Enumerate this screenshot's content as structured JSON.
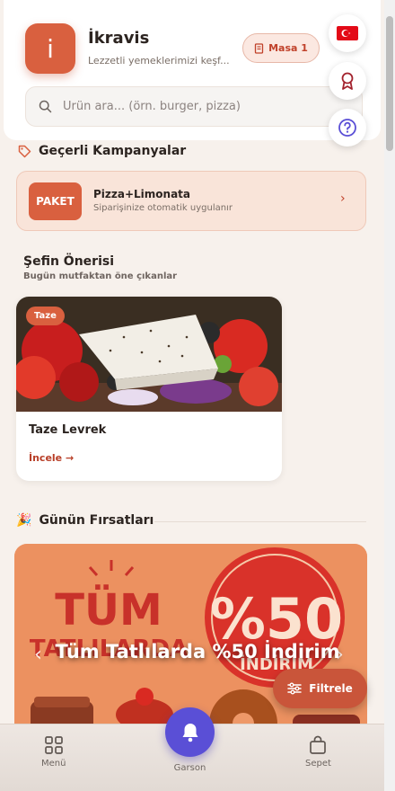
{
  "header": {
    "logo_letter": "i",
    "title": "İkravis",
    "subtitle": "Lezzetli yemeklerimizi keşf...",
    "table_label": "Masa 1"
  },
  "search": {
    "placeholder": "Ürün ara... (örn. burger, pizza)"
  },
  "fabs": [
    {
      "icon": "turkey-flag-icon"
    },
    {
      "icon": "award-icon"
    },
    {
      "icon": "help-icon"
    }
  ],
  "campaigns": {
    "heading": "Geçerli Kampanyalar",
    "items": [
      {
        "badge": "PAKET",
        "title": "Pizza+Limonata",
        "subtitle": "Siparişinize otomatik uygulanır"
      }
    ]
  },
  "chef": {
    "heading": "Şefin Önerisi",
    "subheading": "Bugün mutfaktan öne çıkanlar",
    "card": {
      "badge": "Taze",
      "name": "Taze Levrek",
      "action": "İncele →"
    }
  },
  "deals": {
    "heading": "Günün Fırsatları",
    "banner_caption": "Tüm Tatlılarda %50 İndirim",
    "banner_art_text": [
      "TÜM",
      "TATLILARDA",
      "%50",
      "İNDİRİM"
    ]
  },
  "filter_button": "Filtrele",
  "bottom_nav": {
    "items": [
      {
        "label": "Menü",
        "icon": "grid-icon"
      },
      {
        "label": "Garson",
        "icon": "bell-icon"
      },
      {
        "label": "Sepet",
        "icon": "bag-icon"
      }
    ]
  },
  "colors": {
    "accent": "#d9603f",
    "accent_dark": "#c0412a",
    "background": "#f7f1ec",
    "garson_button": "#5a4fd6"
  }
}
